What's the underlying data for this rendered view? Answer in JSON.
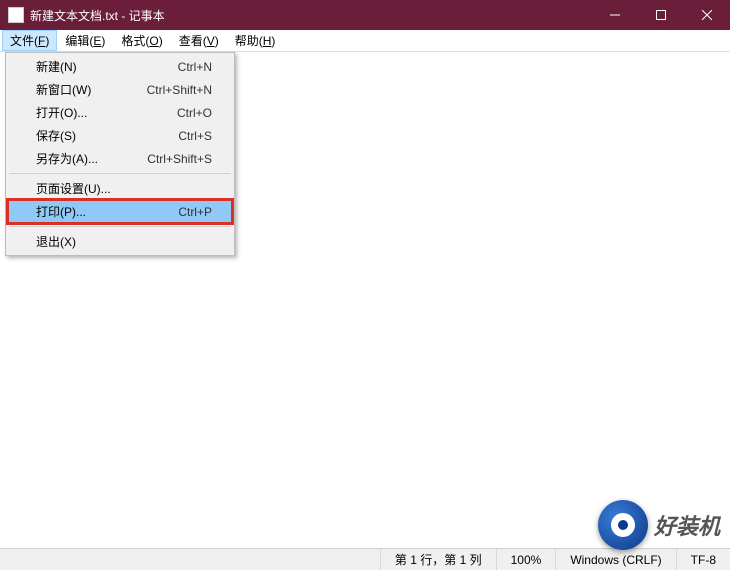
{
  "titlebar": {
    "text": "新建文本文档.txt - 记事本"
  },
  "menubar": {
    "items": [
      {
        "label": "文件(",
        "underline": "F",
        "tail": ")"
      },
      {
        "label": "编辑(",
        "underline": "E",
        "tail": ")"
      },
      {
        "label": "格式(",
        "underline": "O",
        "tail": ")"
      },
      {
        "label": "查看(",
        "underline": "V",
        "tail": ")"
      },
      {
        "label": "帮助(",
        "underline": "H",
        "tail": ")"
      }
    ]
  },
  "dropdown": {
    "new": {
      "label": "新建(N)",
      "shortcut": "Ctrl+N"
    },
    "newwin": {
      "label": "新窗口(W)",
      "shortcut": "Ctrl+Shift+N"
    },
    "open": {
      "label": "打开(O)...",
      "shortcut": "Ctrl+O"
    },
    "save": {
      "label": "保存(S)",
      "shortcut": "Ctrl+S"
    },
    "saveas": {
      "label": "另存为(A)...",
      "shortcut": "Ctrl+Shift+S"
    },
    "pagesetup": {
      "label": "页面设置(U)..."
    },
    "print": {
      "label": "打印(P)...",
      "shortcut": "Ctrl+P"
    },
    "exit": {
      "label": "退出(X)"
    }
  },
  "statusbar": {
    "pos": "第 1 行，第 1 列",
    "zoom": "100%",
    "eol": "Windows (CRLF)",
    "encoding": "TF-8"
  },
  "watermark": {
    "text": "好装机"
  }
}
